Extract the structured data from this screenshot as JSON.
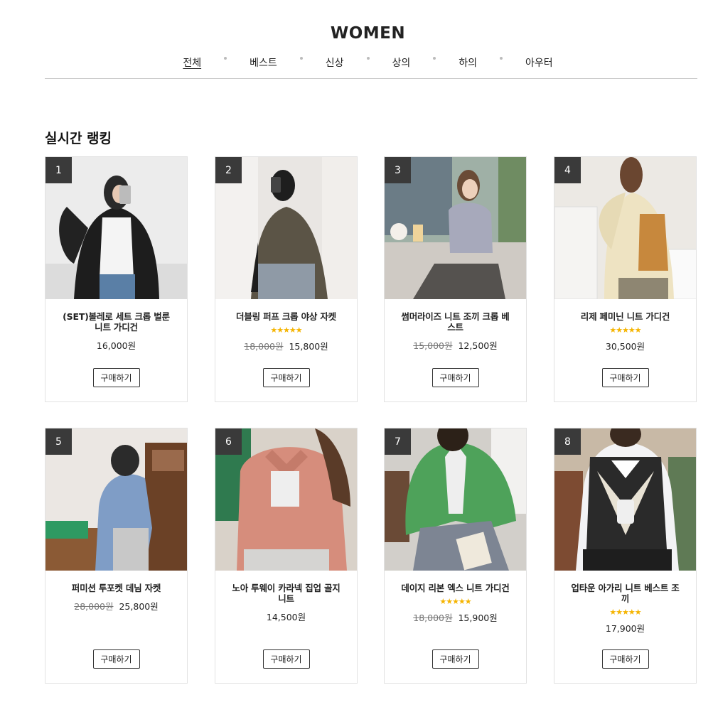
{
  "page_title": "WOMEN",
  "categories": [
    {
      "label": "전체",
      "active": true
    },
    {
      "label": "베스트"
    },
    {
      "label": "신상"
    },
    {
      "label": "상의"
    },
    {
      "label": "하의"
    },
    {
      "label": "아우터"
    }
  ],
  "section_title": "실시간 랭킹",
  "products": [
    {
      "rank": "1",
      "name": "(SET)볼레로 세트 크롭 벌룬 니트 가디건",
      "rating": "",
      "old_price": "",
      "price": "16,000원",
      "buy_label": "구매하기"
    },
    {
      "rank": "2",
      "name": "더블링 퍼프 크롭 야상 자켓",
      "rating": "★★★★★",
      "old_price": "18,000원",
      "price": "15,800원",
      "buy_label": "구매하기"
    },
    {
      "rank": "3",
      "name": "썸머라이즈 니트 조끼 크롭 베스트",
      "rating": "",
      "old_price": "15,000원",
      "price": "12,500원",
      "buy_label": "구매하기"
    },
    {
      "rank": "4",
      "name": "리제 페미닌 니트 가디건",
      "rating": "★★★★★",
      "old_price": "",
      "price": "30,500원",
      "buy_label": "구매하기"
    },
    {
      "rank": "5",
      "name": "퍼미션 투포켓 데님 자켓",
      "rating": "",
      "old_price": "28,000원",
      "price": "25,800원",
      "buy_label": "구매하기"
    },
    {
      "rank": "6",
      "name": "노아 투웨이 카라넥 집업 골지 니트",
      "rating": "",
      "old_price": "",
      "price": "14,500원",
      "buy_label": "구매하기"
    },
    {
      "rank": "7",
      "name": "데이지 리본 엑스 니트 가디건",
      "rating": "★★★★★",
      "old_price": "18,000원",
      "price": "15,900원",
      "buy_label": "구매하기"
    },
    {
      "rank": "8",
      "name": "업타운 아가리 니트 베스트 조끼",
      "rating": "★★★★★",
      "old_price": "",
      "price": "17,900원",
      "buy_label": "구매하기"
    }
  ]
}
